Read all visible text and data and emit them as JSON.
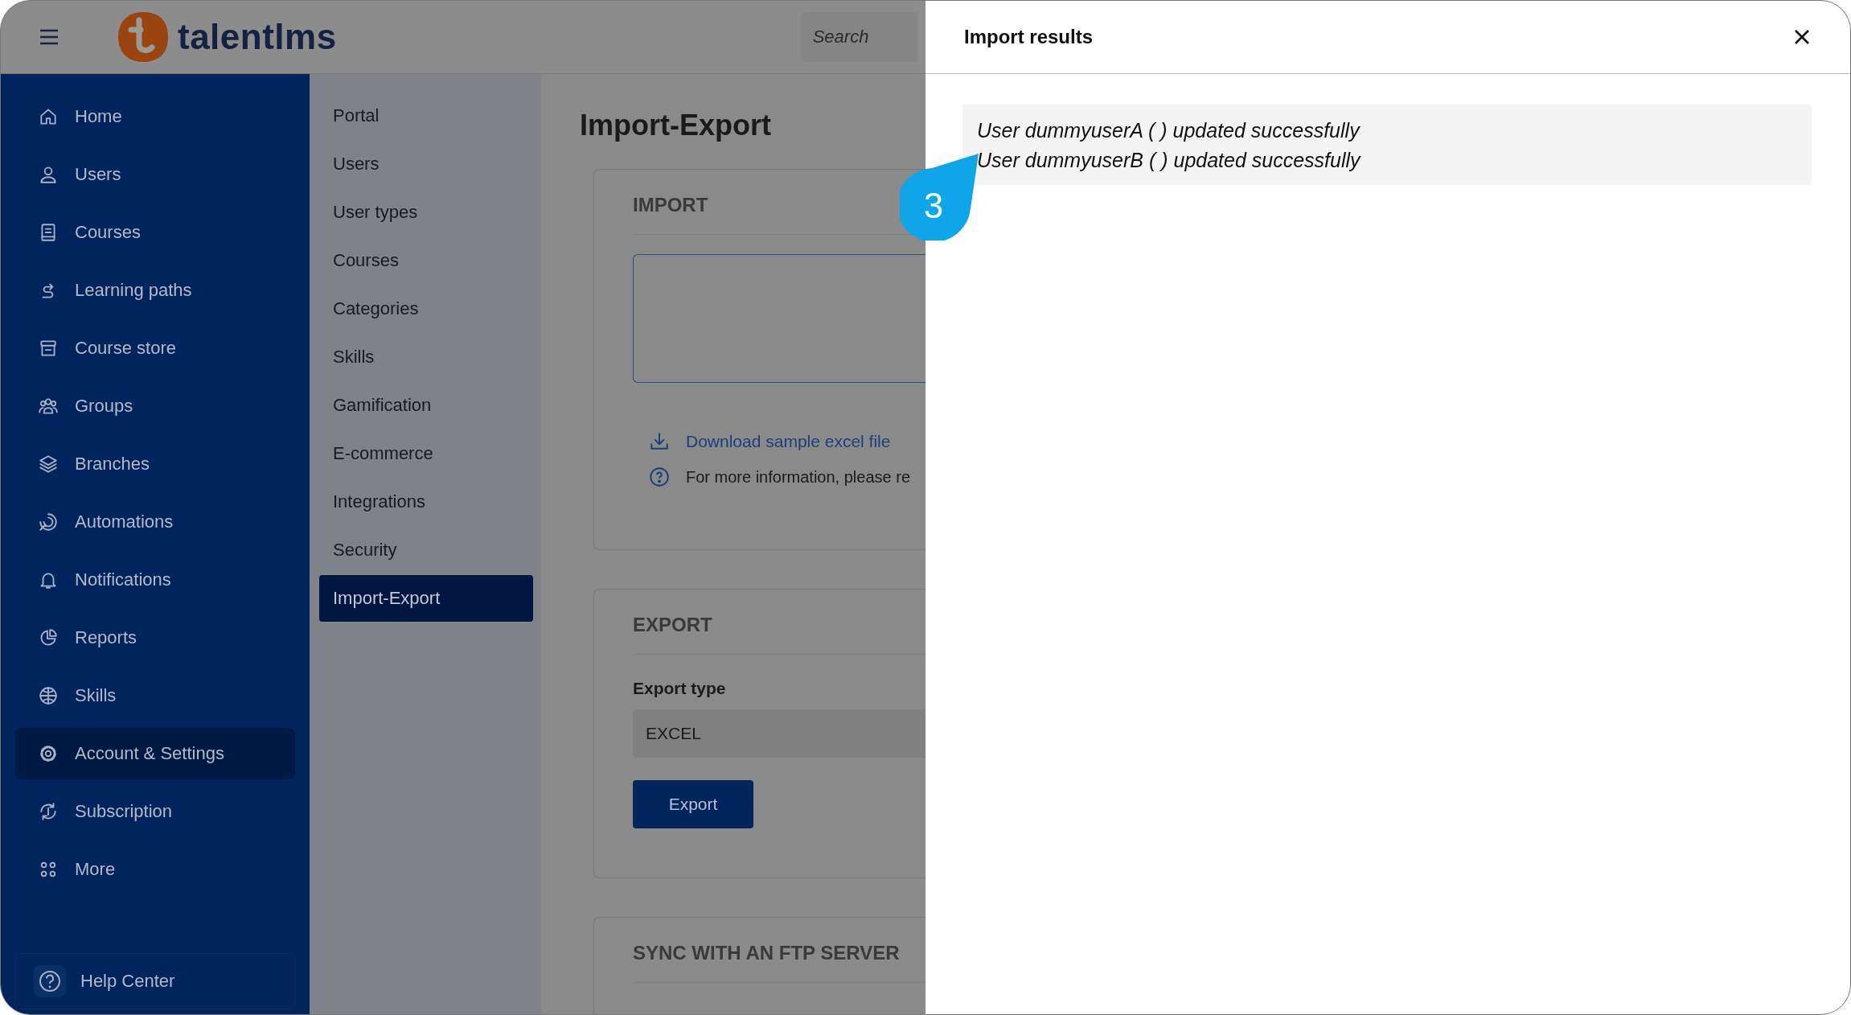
{
  "header": {
    "logo_text": "talentlms",
    "search": {
      "placeholder": "Search"
    }
  },
  "sidebar": {
    "items": [
      {
        "label": "Home",
        "selected": false
      },
      {
        "label": "Users",
        "selected": false
      },
      {
        "label": "Courses",
        "selected": false
      },
      {
        "label": "Learning paths",
        "selected": false
      },
      {
        "label": "Course store",
        "selected": false
      },
      {
        "label": "Groups",
        "selected": false
      },
      {
        "label": "Branches",
        "selected": false
      },
      {
        "label": "Automations",
        "selected": false
      },
      {
        "label": "Notifications",
        "selected": false
      },
      {
        "label": "Reports",
        "selected": false
      },
      {
        "label": "Skills",
        "selected": false
      },
      {
        "label": "Account & Settings",
        "selected": true
      },
      {
        "label": "Subscription",
        "selected": false
      },
      {
        "label": "More",
        "selected": false
      }
    ],
    "help": {
      "label": "Help Center"
    }
  },
  "submenu": {
    "items": [
      {
        "label": "Portal",
        "selected": false
      },
      {
        "label": "Users",
        "selected": false
      },
      {
        "label": "User types",
        "selected": false
      },
      {
        "label": "Courses",
        "selected": false
      },
      {
        "label": "Categories",
        "selected": false
      },
      {
        "label": "Skills",
        "selected": false
      },
      {
        "label": "Gamification",
        "selected": false
      },
      {
        "label": "E-commerce",
        "selected": false
      },
      {
        "label": "Integrations",
        "selected": false
      },
      {
        "label": "Security",
        "selected": false
      },
      {
        "label": "Import-Export",
        "selected": true
      }
    ]
  },
  "page": {
    "title": "Import-Export",
    "import": {
      "heading": "IMPORT",
      "download_link": "Download sample excel file",
      "info_text": "For more information, please re"
    },
    "export": {
      "heading": "EXPORT",
      "type_label": "Export type",
      "type_value": "EXCEL",
      "button": "Export"
    },
    "sync": {
      "heading": "SYNC WITH AN FTP SERVER"
    }
  },
  "results_panel": {
    "title": "Import results",
    "messages": [
      "User dummyuserA ( ) updated successfully",
      "User dummyuserB ( ) updated successfully"
    ]
  },
  "callout": {
    "label": "3"
  }
}
